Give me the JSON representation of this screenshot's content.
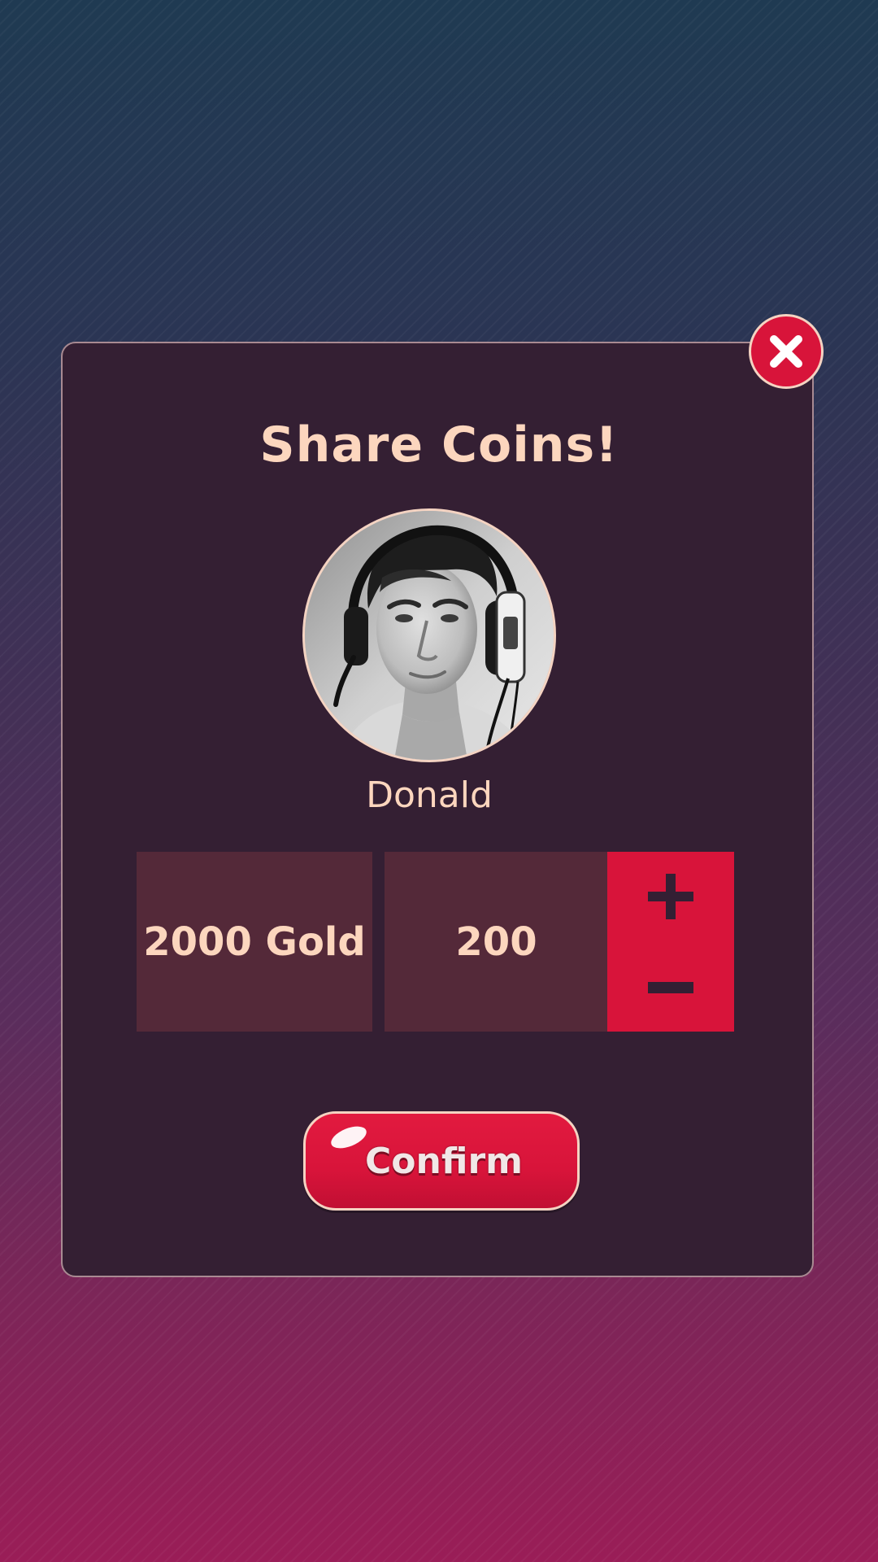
{
  "dialog": {
    "title": "Share Coins!",
    "username": "Donald",
    "avatar": "headphones-portrait",
    "close_icon": "close-icon"
  },
  "transfer": {
    "balance_label": "2000 Gold",
    "amount": "200",
    "increment_icon": "plus-icon",
    "decrement_icon": "minus-icon"
  },
  "actions": {
    "confirm_label": "Confirm"
  },
  "colors": {
    "accent": "#d8143a",
    "text": "#fcd6be",
    "panel": "#341f33",
    "box": "#542939"
  }
}
